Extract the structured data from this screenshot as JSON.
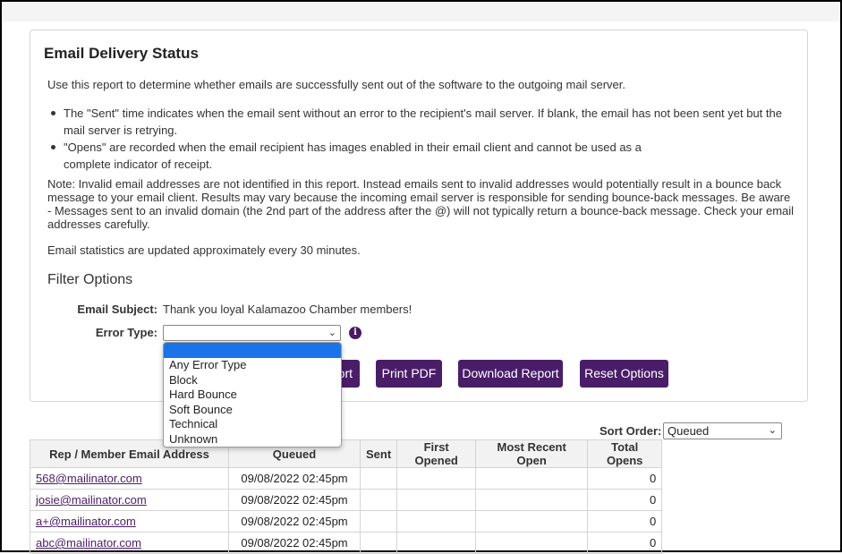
{
  "panel": {
    "title": "Email Delivery Status",
    "intro": "Use this report to determine whether emails are successfully sent out of the software to the outgoing mail server.",
    "bullets": [
      "The \"Sent\" time indicates when the email sent without an error to the recipient's mail server. If blank, the email has not been sent yet but the mail server is retrying.",
      "\"Opens\" are recorded when the email recipient has images enabled in their email client and cannot be used as a complete indicator of receipt."
    ],
    "note": "Note: Invalid email addresses are not identified in this report. Instead emails sent to invalid addresses would potentially result in a bounce back message to your email client. Results may vary because the incoming email server is responsible for sending bounce-back messages. Be aware - Messages sent to an invalid domain (the 2nd part of the address after the @) will not typically return a bounce-back message. Check your email addresses carefully.",
    "stats_note": "Email statistics are updated approximately every 30 minutes.",
    "filter_heading": "Filter Options"
  },
  "filters": {
    "subject_label": "Email Subject:",
    "subject_value": "Thank you loyal Kalamazoo Chamber members!",
    "error_type_label": "Error Type:",
    "error_type_value": "",
    "error_type_options": [
      "",
      "Any Error Type",
      "Block",
      "Hard Bounce",
      "Soft Bounce",
      "Technical",
      "Unknown"
    ]
  },
  "buttons": {
    "report": "Report",
    "print_pdf": "Print PDF",
    "download_report": "Download Report",
    "reset_options": "Reset Options"
  },
  "sort": {
    "label": "Sort Order:",
    "value": "Queued"
  },
  "table": {
    "headers": [
      "Rep / Member Email Address",
      "Queued",
      "Sent",
      "First Opened",
      "Most Recent Open",
      "Total Opens"
    ],
    "rows": [
      {
        "email": "568@mailinator.com",
        "queued": "09/08/2022 02:45pm",
        "sent": "",
        "first_opened": "",
        "most_recent": "",
        "total": "0"
      },
      {
        "email": "josie@mailinator.com",
        "queued": "09/08/2022 02:45pm",
        "sent": "",
        "first_opened": "",
        "most_recent": "",
        "total": "0"
      },
      {
        "email": "a+@mailinator.com",
        "queued": "09/08/2022 02:45pm",
        "sent": "",
        "first_opened": "",
        "most_recent": "",
        "total": "0"
      },
      {
        "email": "abc@mailinator.com",
        "queued": "09/08/2022 02:45pm",
        "sent": "",
        "first_opened": "",
        "most_recent": "",
        "total": "0"
      }
    ]
  },
  "colors": {
    "accent": "#4a1d68",
    "dropdown_highlight": "#1a73e8"
  }
}
